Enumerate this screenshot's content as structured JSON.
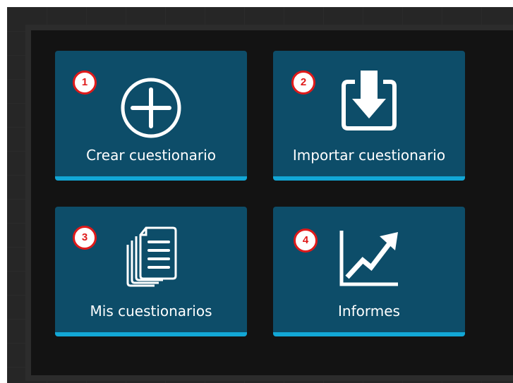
{
  "menu": {
    "tiles": [
      {
        "label": "Crear cuestionario",
        "badge": "1",
        "icon": "plus-circle-icon"
      },
      {
        "label": "Importar cuestionario",
        "badge": "2",
        "icon": "import-icon"
      },
      {
        "label": "Mis cuestionarios",
        "badge": "3",
        "icon": "documents-icon"
      },
      {
        "label": "Informes",
        "badge": "4",
        "icon": "chart-up-icon"
      }
    ]
  },
  "colors": {
    "tile_bg": "#0d4d69",
    "tile_accent": "#12a7d6",
    "badge_ring": "#e01a1a",
    "panel_bg": "#131313",
    "page_bg": "#262626"
  }
}
